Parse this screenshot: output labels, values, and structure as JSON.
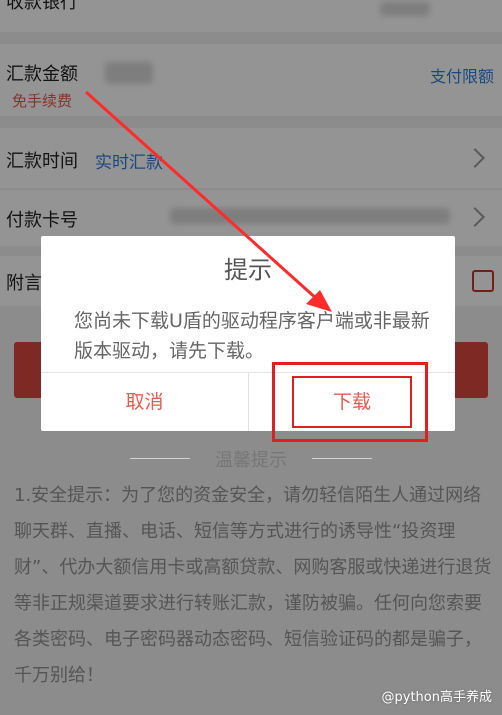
{
  "form": {
    "bank_label": "收款银行",
    "amount_label": "汇款金额",
    "fee_badge": "免手续费",
    "limit_link": "支付限额",
    "time_label": "汇款时间",
    "time_value": "实时汇款",
    "card_label": "付款卡号",
    "memo_label": "附言"
  },
  "dialog": {
    "title": "提示",
    "message": "您尚未下载U盾的驱动程序客户端或非最新版本驱动，请先下载。",
    "cancel_label": "取消",
    "download_label": "下载"
  },
  "tips": {
    "title": "温馨提示",
    "body": "1.安全提示：为了您的资金安全，请勿轻信陌生人通过网络聊天群、直播、电话、短信等方式进行的诱导性“投资理财”、代办大额信用卡或高额贷款、网购客服或快递进行退货等非正规渠道要求进行转账汇款，谨防被骗。任何向您索要各类密码、电子密码器动态密码、短信验证码的都是骗子，千万别给！"
  },
  "watermark": "@python高手养成",
  "colors": {
    "accent": "#e8594f",
    "link": "#2f7fd8",
    "highlight": "#e02020"
  }
}
